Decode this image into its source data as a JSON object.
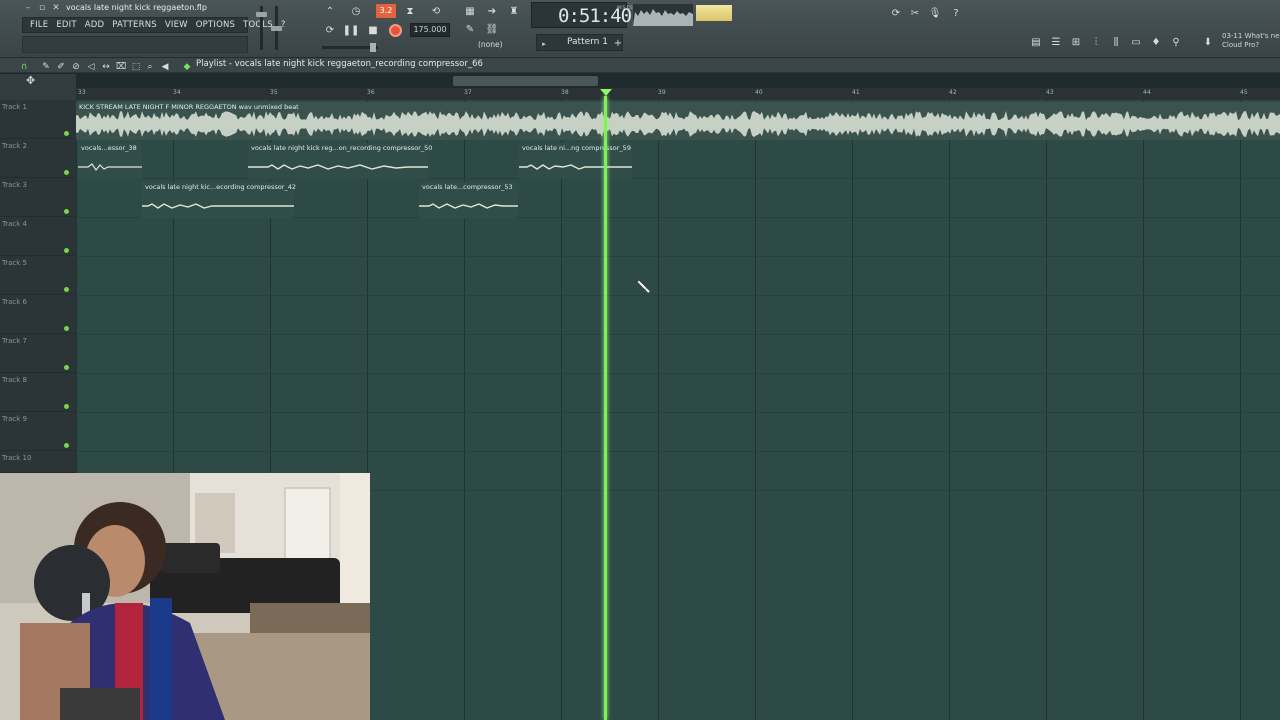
{
  "window": {
    "file_title": "vocals late night kick reggaeton.flp",
    "menu": [
      "FILE",
      "EDIT",
      "ADD",
      "PATTERNS",
      "VIEW",
      "OPTIONS",
      "TOOLS",
      "?"
    ]
  },
  "transport": {
    "pattern_mode_label": "3.2",
    "tempo": "175.000",
    "time": "0:51:40",
    "time_unit": "M:S:CS",
    "snap": "(none)",
    "pattern": "Pattern 1"
  },
  "news": {
    "line1": "03-11  What's ne",
    "line2": "Cloud Pro?"
  },
  "playlist": {
    "title": "Playlist - vocals late night kick reggaeton_recording compressor_66",
    "ruler": [
      "33",
      "34",
      "35",
      "36",
      "37",
      "38",
      "39",
      "40",
      "41",
      "42",
      "43",
      "44",
      "45"
    ],
    "tracks": [
      "Track 1",
      "Track 2",
      "Track 3",
      "Track 4",
      "Track 5",
      "Track 6",
      "Track 7",
      "Track 8",
      "Track 9",
      "Track 10"
    ],
    "clips": {
      "beat": "KICK STREAM LATE NIGHT F MINOR REGGAETON wav unmixed beat",
      "c38": "vocals...essor_38",
      "c50": "vocals late night kick reg...on_recording compressor_50",
      "c59": "vocals late ni...ng compressor_59",
      "c42": "vocals late night kic...ecording compressor_42",
      "c53": "vocals late...compressor_53"
    }
  },
  "colors": {
    "playhead": "#7ef05a",
    "grid": "#2e4a47",
    "record": "#e8553a"
  }
}
